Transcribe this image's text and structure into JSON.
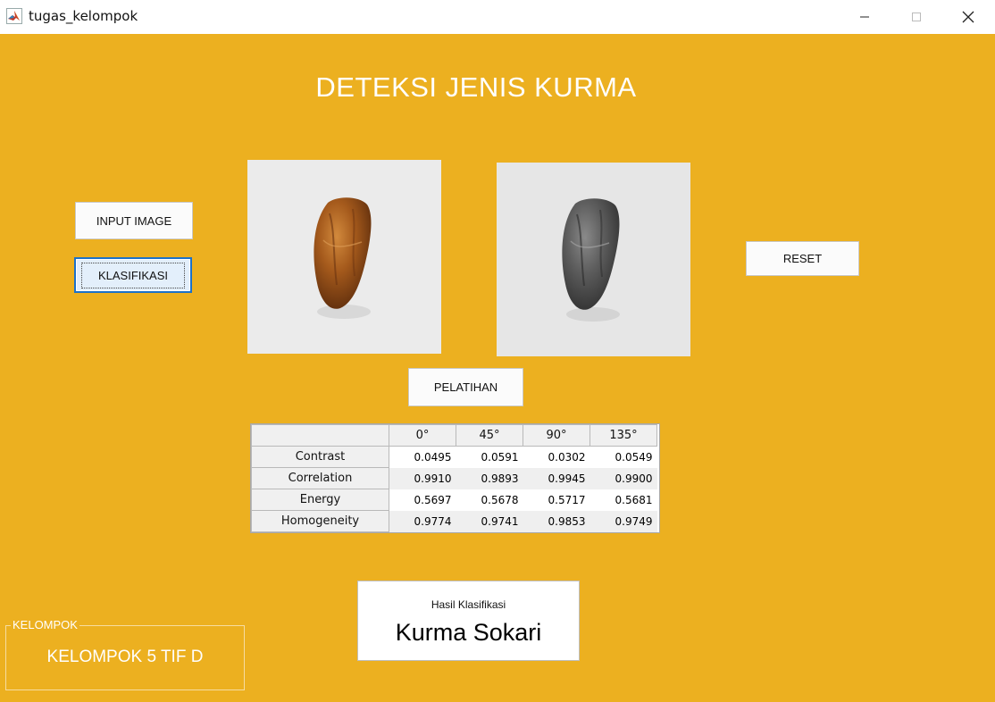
{
  "window": {
    "title": "tugas_kelompok",
    "icon": "matlab-icon"
  },
  "main": {
    "title": "DETEKSI JENIS KURMA",
    "buttons": {
      "input_image": "INPUT IMAGE",
      "klasifikasi": "KLASIFIKASI",
      "reset": "RESET",
      "pelatihan": "PELATIHAN"
    },
    "images": {
      "original": "date-fruit-color-image",
      "grayscale": "date-fruit-grayscale-image"
    }
  },
  "glcm_table": {
    "columns": [
      "0°",
      "45°",
      "90°",
      "135°"
    ],
    "rows": [
      {
        "label": "Contrast",
        "values": [
          "0.0495",
          "0.0591",
          "0.0302",
          "0.0549"
        ]
      },
      {
        "label": "Correlation",
        "values": [
          "0.9910",
          "0.9893",
          "0.9945",
          "0.9900"
        ]
      },
      {
        "label": "Energy",
        "values": [
          "0.5697",
          "0.5678",
          "0.5717",
          "0.5681"
        ]
      },
      {
        "label": "Homogeneity",
        "values": [
          "0.9774",
          "0.9741",
          "0.9853",
          "0.9749"
        ]
      }
    ]
  },
  "result": {
    "label": "Hasil Klasifikasi",
    "value": "Kurma Sokari"
  },
  "group": {
    "legend": "KELOMPOK",
    "text": "KELOMPOK 5 TIF D"
  },
  "colors": {
    "background": "#ecb020",
    "focus_border": "#1c71c9"
  }
}
